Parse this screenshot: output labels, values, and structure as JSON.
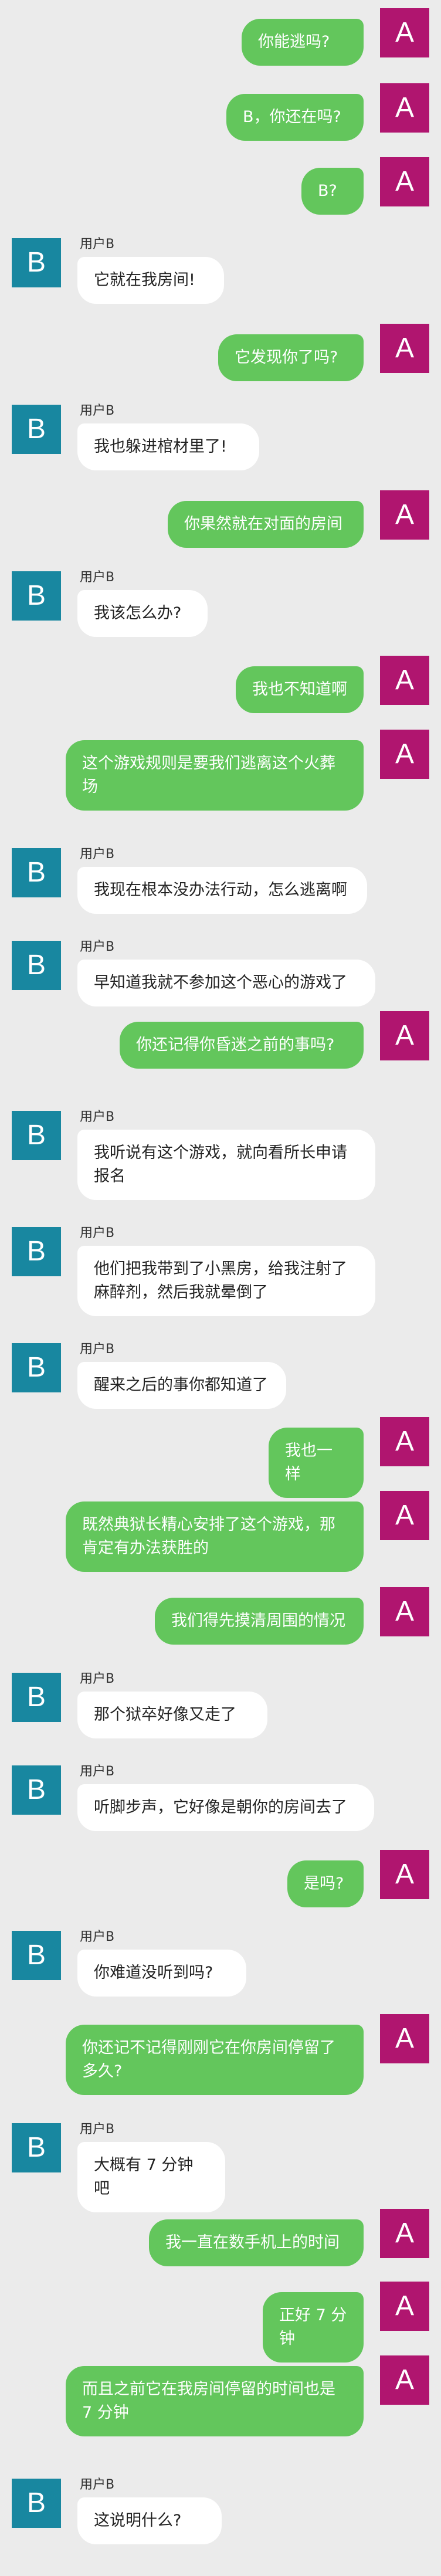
{
  "chat": {
    "self_avatar_letter": "A",
    "other_avatar_letter": "B",
    "other_name": "用户B",
    "colors": {
      "background": "#ebebeb",
      "self_bubble": "#63c65c",
      "other_bubble": "#ffffff",
      "self_avatar": "#b0156f",
      "other_avatar": "#1887a0"
    },
    "messages": [
      {
        "sender": "self",
        "text": "你能逃吗?"
      },
      {
        "sender": "self",
        "text": "B，你还在吗?"
      },
      {
        "sender": "self",
        "text": "B?"
      },
      {
        "sender": "other",
        "text": "它就在我房间!"
      },
      {
        "sender": "self",
        "text": "它发现你了吗?"
      },
      {
        "sender": "other",
        "text": "我也躲进棺材里了!"
      },
      {
        "sender": "self",
        "text": "你果然就在对面的房间"
      },
      {
        "sender": "other",
        "text": "我该怎么办?"
      },
      {
        "sender": "self",
        "text": "我也不知道啊"
      },
      {
        "sender": "self",
        "text": "这个游戏规则是要我们逃离这个火葬场"
      },
      {
        "sender": "other",
        "text": "我现在根本没办法行动，怎么逃离啊"
      },
      {
        "sender": "other",
        "text": "早知道我就不参加这个恶心的游戏了"
      },
      {
        "sender": "self",
        "text": "你还记得你昏迷之前的事吗?"
      },
      {
        "sender": "other",
        "text": "我听说有这个游戏，就向看所长申请报名"
      },
      {
        "sender": "other",
        "text": "他们把我带到了小黑房，给我注射了麻醉剂，然后我就晕倒了"
      },
      {
        "sender": "other",
        "text": "醒来之后的事你都知道了"
      },
      {
        "sender": "self",
        "text": "我也一样"
      },
      {
        "sender": "self",
        "text": "既然典狱长精心安排了这个游戏，那肯定有办法获胜的"
      },
      {
        "sender": "self",
        "text": "我们得先摸清周围的情况"
      },
      {
        "sender": "other",
        "text": "那个狱卒好像又走了"
      },
      {
        "sender": "other",
        "text": "听脚步声，它好像是朝你的房间去了"
      },
      {
        "sender": "self",
        "text": "是吗?"
      },
      {
        "sender": "other",
        "text": "你难道没听到吗?"
      },
      {
        "sender": "self",
        "text": "你还记不记得刚刚它在你房间停留了多久?"
      },
      {
        "sender": "other",
        "text": "大概有 7 分钟吧"
      },
      {
        "sender": "self",
        "text": "我一直在数手机上的时间"
      },
      {
        "sender": "self",
        "text": "正好 7 分钟"
      },
      {
        "sender": "self",
        "text": "而且之前它在我房间停留的时间也是 7 分钟"
      },
      {
        "sender": "other",
        "text": "这说明什么?"
      }
    ]
  }
}
